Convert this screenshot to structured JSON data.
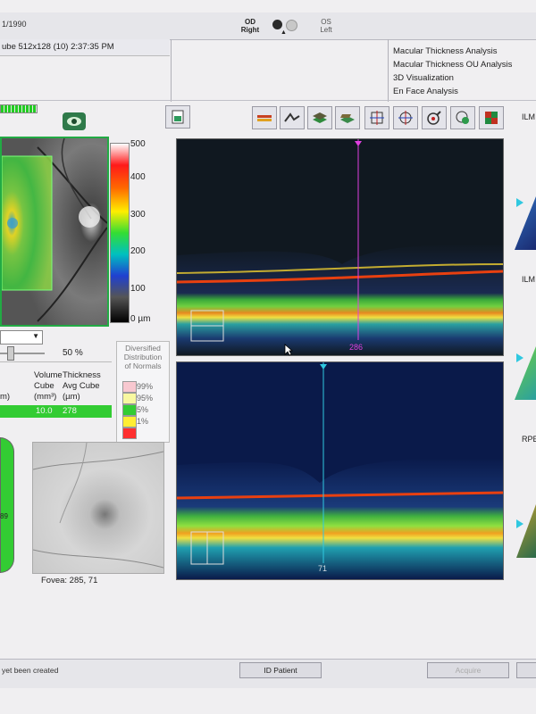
{
  "header": {
    "date": "1/1990",
    "eye_right": "OD\nRight",
    "eye_right_line1": "OD",
    "eye_right_line2": "Right",
    "eye_left_line1": "OS",
    "eye_left_line2": "Left",
    "scan_info": "ube 512x128 (10) 2:37:35 PM"
  },
  "analyses": [
    "Macular Thickness Analysis",
    "Macular Thickness OU Analysis",
    "3D Visualization",
    "En Face Analysis"
  ],
  "colorbar": {
    "labels": [
      "500",
      "400",
      "300",
      "200",
      "100",
      "0 µm"
    ]
  },
  "controls": {
    "opacity": "50 %"
  },
  "table": {
    "col1_top": "Volume",
    "col1_mid": "Cube",
    "col1_unit": "(mm³)",
    "col2_top": "Thickness",
    "col2_mid": "Avg Cube",
    "col2_unit": "(µm)",
    "col0_unit": "m)",
    "volume": "10.0",
    "thickness": "278"
  },
  "distribution": {
    "title_lines": [
      "Diversified",
      "Distribution",
      "of Normals"
    ],
    "levels": [
      {
        "label": "99%",
        "color": "#f8c8d0"
      },
      {
        "label": "95%",
        "color": "#f8f8a0"
      },
      {
        "label": "5%",
        "color": "#33cc33"
      },
      {
        "label": "1%",
        "color": "#ffee33"
      },
      {
        "label": "",
        "color": "#ff3030"
      }
    ]
  },
  "fovea": {
    "label": "Fovea: 285, 71"
  },
  "circle_value": "89",
  "scan_top": {
    "slice": "286"
  },
  "scan_bottom": {
    "slice": "71"
  },
  "right_labels": [
    "ILM",
    "ILM",
    "RPE"
  ],
  "footer": {
    "status": "yet been created",
    "id_patient": "ID Patient",
    "acquire": "Acquire"
  },
  "colors": {
    "border_green": "#22aa44",
    "magenta": "#e040e0",
    "cyan": "#30c8e0"
  },
  "icons": [
    "report-icon",
    "layer-icon",
    "segment-icon",
    "stack-icon",
    "flip-icon",
    "crosshair-icon",
    "target-icon",
    "registration-icon",
    "grid-icon",
    "eye-icon"
  ]
}
